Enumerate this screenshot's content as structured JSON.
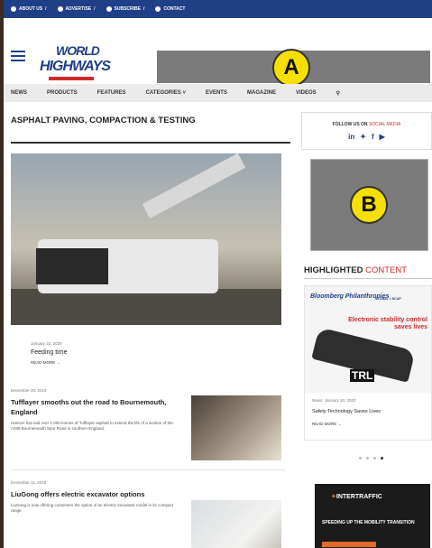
{
  "topbar": {
    "links": [
      "ABOUT US",
      "ADVERTISE",
      "SUBSCRIBE",
      "CONTACT"
    ]
  },
  "logo": {
    "line1": "WORLD",
    "line2": "HIGHWAYS"
  },
  "ads": {
    "a_label": "A",
    "b_label": "B"
  },
  "nav": {
    "items": [
      "NEWS",
      "PRODUCTS",
      "FEATURES",
      "CATEGORIES ˅",
      "EVENTS",
      "MAGAZINE",
      "VIDEOS"
    ]
  },
  "section": {
    "title": "ASPHALT PAVING, COMPACTION & TESTING"
  },
  "follow": {
    "label_strong": "FOLLOW US ON",
    "label_accent": "SOCIAL MEDIA",
    "icons": [
      "in",
      "𝕨",
      "f",
      "▶"
    ]
  },
  "hero": {
    "date": "January 22, 2020",
    "title": "Feeding time",
    "read_more": "READ MORE"
  },
  "articles": [
    {
      "date": "December 20, 2019",
      "title": "Tufflayer smooths out the road to Bournemouth, England",
      "desc": "Hanson has laid over 1,000 tonnes of Tufflayer asphalt to extend the life of a section of the A338 Bournemouth Spur Road in southern England."
    },
    {
      "date": "December 11, 2019",
      "title": "LiuGong offers electric excavator options",
      "desc": "LiuGong is now offering customers the option of an electric excavator model in its compact range."
    }
  ],
  "highlighted": {
    "title_strong": "HIGHLIGHTED",
    "title_accent": "CONTENT",
    "promo": {
      "brand": "Bloomberg Philanthropies",
      "partner": "GLOBAL ● NCAP",
      "headline": "Electronic stability control saves lives",
      "trl": "TRL",
      "date": "News: January 10, 2020",
      "title": "Safety Technology Saves Lives",
      "read_more": "READ MORE"
    }
  },
  "intertraffic": {
    "brand": "INTERTRAFFIC",
    "subtitle": "SPEEDING UP THE MOBILITY TRANSITION"
  },
  "colors": {
    "brand": "#1f3f86",
    "accent": "#d02a2a",
    "ad_gray": "#7b7b7b",
    "badge": "#f6e000"
  }
}
